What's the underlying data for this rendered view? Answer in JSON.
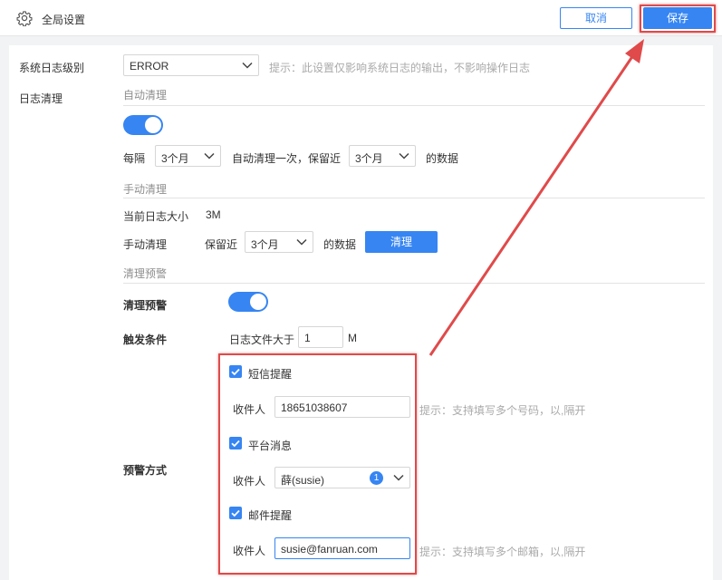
{
  "header": {
    "title": "全局设置",
    "cancel_label": "取消",
    "save_label": "保存"
  },
  "log_level": {
    "label": "系统日志级别",
    "value": "ERROR",
    "hint": "提示：此设置仅影响系统日志的输出，不影响操作日志"
  },
  "log_cleanup": {
    "label": "日志清理",
    "auto": {
      "section_title": "自动清理",
      "enabled": true,
      "every_label": "每隔",
      "interval_value": "3个月",
      "once_label": "自动清理一次，保留近",
      "keep_value": "3个月",
      "data_suffix": "的数据"
    },
    "manual": {
      "section_title": "手动清理",
      "size_label": "当前日志大小",
      "size_value": "3M",
      "action_label": "手动清理",
      "keep_label": "保留近",
      "keep_value": "3个月",
      "data_suffix": "的数据",
      "button_label": "清理"
    },
    "alert": {
      "section_title": "清理预警",
      "toggle_label": "清理预警",
      "enabled": true,
      "trigger_label": "触发条件",
      "file_size_label": "日志文件大于",
      "file_size_value": "1",
      "file_size_unit": "M",
      "method_label": "预警方式",
      "sms": {
        "checked": true,
        "label": "短信提醒",
        "recipient_label": "收件人",
        "recipient_value": "18651038607",
        "hint": "提示：支持填写多个号码，以,隔开"
      },
      "platform": {
        "checked": true,
        "label": "平台消息",
        "recipient_label": "收件人",
        "recipient_value": "薛(susie)",
        "count": "1"
      },
      "email": {
        "checked": true,
        "label": "邮件提醒",
        "recipient_label": "收件人",
        "recipient_value": "susie@fanruan.com",
        "hint": "提示：支持填写多个邮箱，以,隔开"
      }
    }
  },
  "colors": {
    "accent": "#3685f2",
    "annotation": "#e04a4a"
  }
}
